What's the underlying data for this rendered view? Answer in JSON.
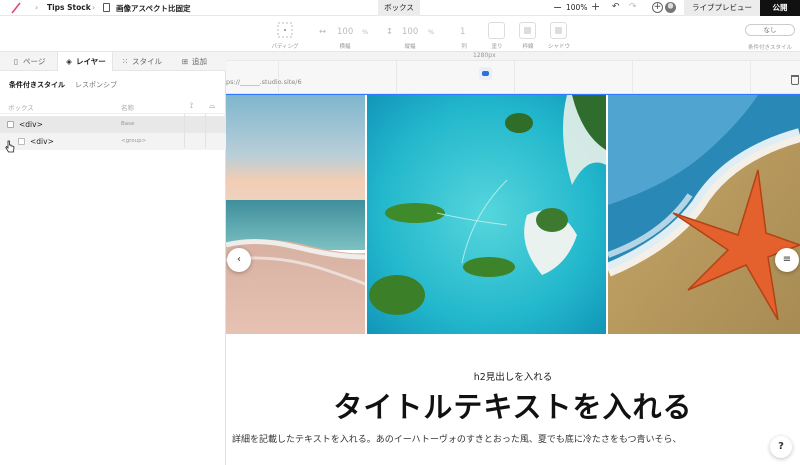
{
  "topbar": {
    "project": "Tips Stock",
    "page": "画像アスペクト比固定",
    "center_tab": "ボックス",
    "zoom": "100%",
    "preview": "ライブプレビュー",
    "publish": "公開"
  },
  "toolbar": {
    "padding_label": "パディング",
    "width_value": "100",
    "width_unit": "%",
    "width_label": "横幅",
    "height_value": "100",
    "height_unit": "%",
    "height_label": "縦幅",
    "count_value": "1",
    "count_label": "列",
    "fill_label": "塗り",
    "border_label": "枠線",
    "shadow_label": "シャドウ",
    "conditional_value": "なし",
    "conditional_label": "条件付きスタイル"
  },
  "panel": {
    "tabs": [
      {
        "label": "ページ",
        "icon": "page-icon"
      },
      {
        "label": "レイヤー",
        "icon": "layers-icon"
      },
      {
        "label": "スタイル",
        "icon": "style-icon"
      },
      {
        "label": "追加",
        "icon": "add-icon"
      }
    ],
    "subtabs": [
      "条件付きスタイル",
      "レスポンシブ"
    ],
    "columns": {
      "box": "ボックス",
      "name": "名称"
    },
    "layers": [
      {
        "name": "<div>",
        "tag": "Base"
      },
      {
        "name": "<div>",
        "tag": "<group>"
      }
    ]
  },
  "canvas": {
    "width_label": "1280px",
    "url": "ps://______.studio.site/6",
    "h2": "h2見出しを入れる",
    "title": "タイトルテキストを入れる",
    "body": "詳細を記載したテキストを入れる。あのイーハトーヴォのすきとおった風、夏でも底に冷たさをもつ青いそら、"
  },
  "help": "?",
  "colors": {
    "accent": "#2f7bff",
    "publish_bg": "#111111"
  }
}
